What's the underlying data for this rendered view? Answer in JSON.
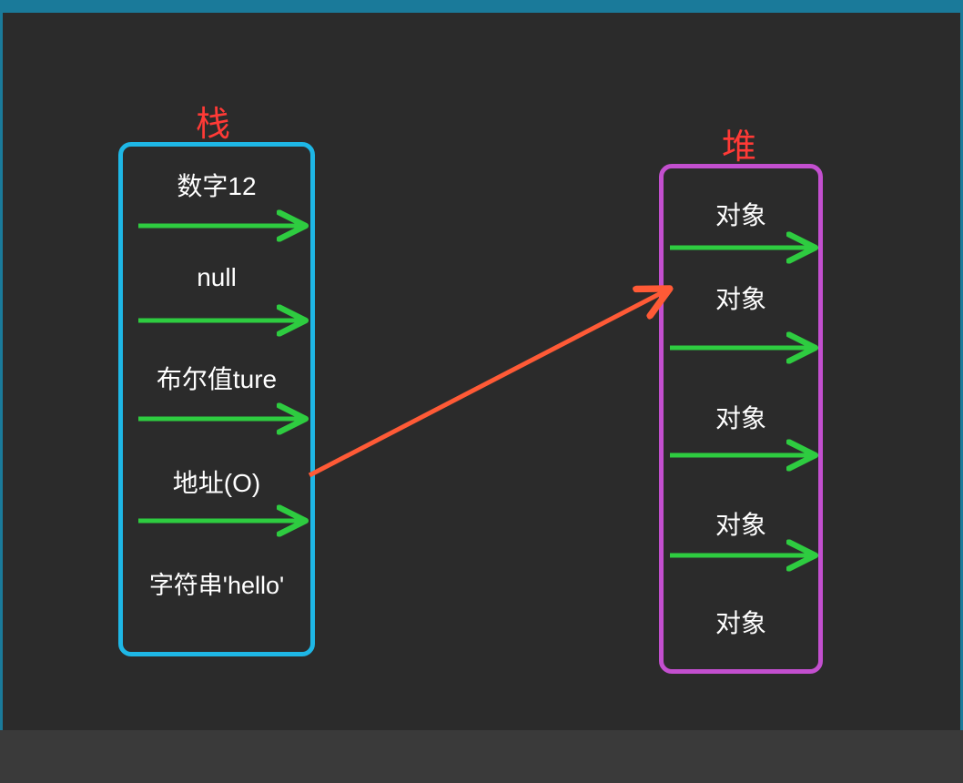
{
  "diagram": {
    "stack_title": "栈",
    "heap_title": "堆",
    "stack_items": [
      "数字12",
      "null",
      "布尔值ture",
      "地址(O)",
      "字符串'hello'"
    ],
    "heap_items": [
      "对象",
      "对象",
      "对象",
      "对象",
      "对象"
    ],
    "colors": {
      "stack_border": "#1eb7e6",
      "heap_border": "#c34fcf",
      "title": "#ff3a36",
      "arrow_green": "#2ecc40",
      "arrow_red": "#ff5a36",
      "text": "#ffffff",
      "bg": "#2b2b2b"
    },
    "pointer": {
      "from": "stack_items.3",
      "to": "heap_items.1"
    }
  }
}
